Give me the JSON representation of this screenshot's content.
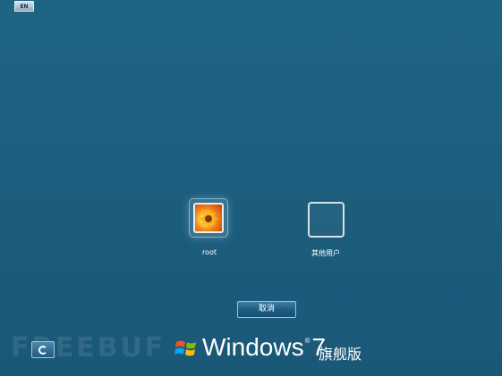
{
  "top_bar": {
    "language_label": "EN"
  },
  "users": [
    {
      "name": "root"
    },
    {
      "name": "其他用户"
    }
  ],
  "actions": {
    "cancel_label": "取消"
  },
  "footer": {
    "watermark": "FREEBUF",
    "brand_windows": "Windows",
    "brand_trademark": "®",
    "brand_version": "7",
    "brand_edition": "旗舰版",
    "ease_of_access_icon": "ease-of-access-icon"
  }
}
